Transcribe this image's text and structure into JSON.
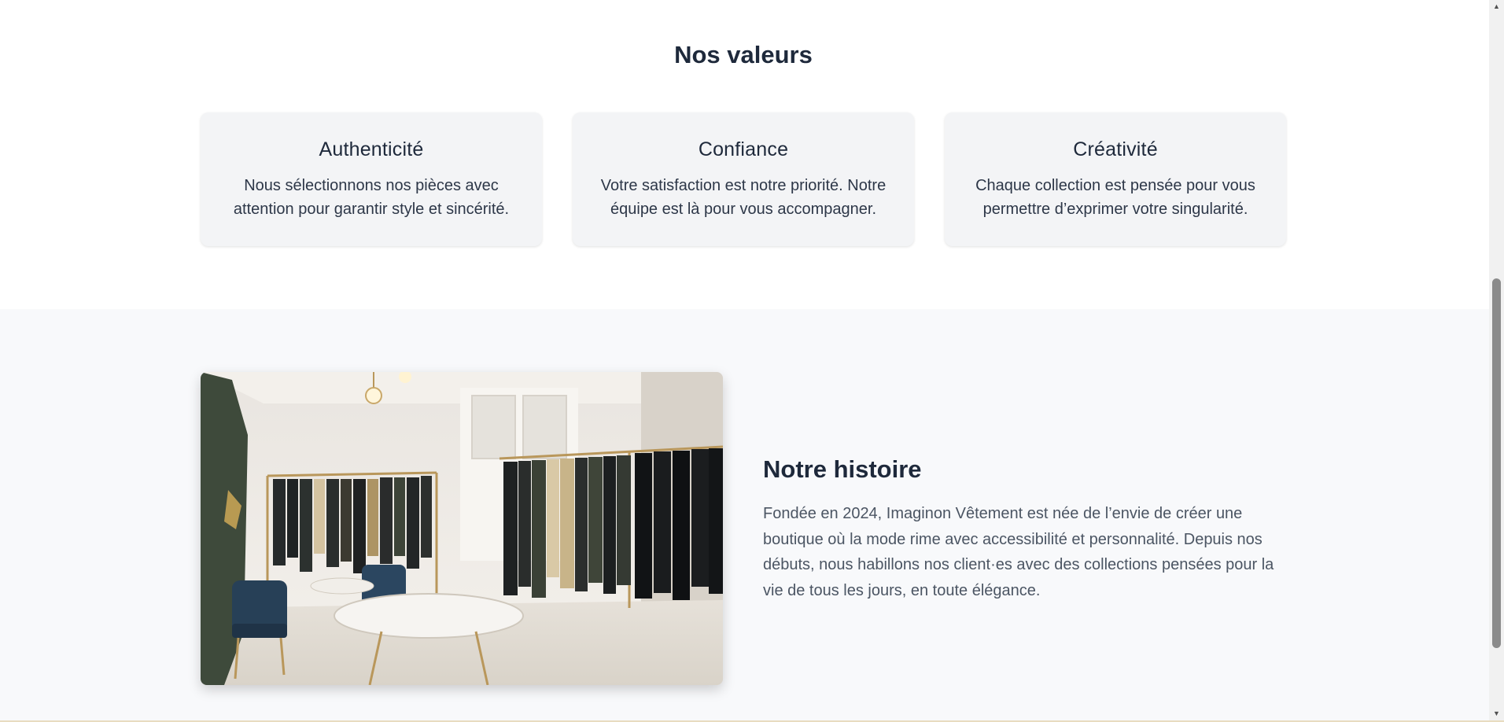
{
  "values": {
    "title": "Nos valeurs",
    "cards": [
      {
        "title": "Authenticité",
        "text": "Nous sélectionnons nos pièces avec attention pour garantir style et sincérité."
      },
      {
        "title": "Confiance",
        "text": "Votre satisfaction est notre priorité. Notre équipe est là pour vous accompagner."
      },
      {
        "title": "Créativité",
        "text": "Chaque collection est pensée pour vous permettre d’exprimer votre singularité."
      }
    ]
  },
  "history": {
    "title": "Notre histoire",
    "text": "Fondée en 2024, Imaginon Vêtement est née de l’envie de créer une boutique où la mode rime avec accessibilité et personnalité. Depuis nos débuts, nous habillons nos client·es avec des collections pensées pour la vie de tous les jours, en toute élégance."
  },
  "icons": {
    "scroll_up": "chevron-up-icon",
    "scroll_down": "chevron-down-icon"
  },
  "colors": {
    "heading": "#1e293b",
    "card_bg": "#f3f4f6",
    "section_bg": "#f8f9fb",
    "body_text": "#4b5563"
  }
}
